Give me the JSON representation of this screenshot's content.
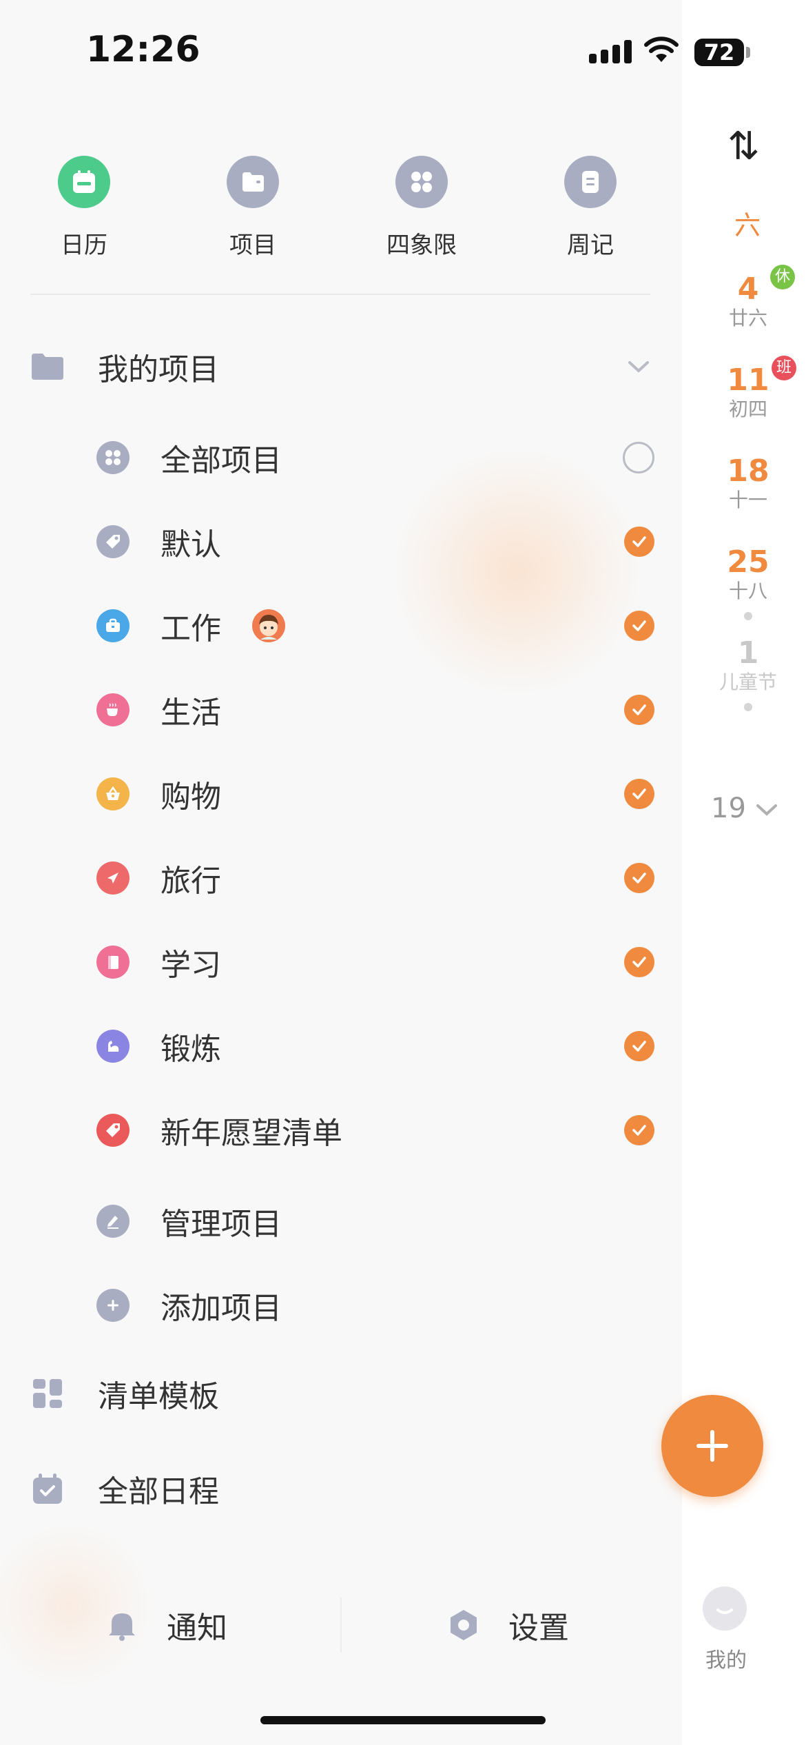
{
  "status_bar": {
    "time": "12:26",
    "battery": "72"
  },
  "shortcuts": [
    {
      "label": "日历",
      "icon": "calendar-icon",
      "color": "#4ccb8a"
    },
    {
      "label": "项目",
      "icon": "folder-icon",
      "color": "#a8adc2"
    },
    {
      "label": "四象限",
      "icon": "quadrant-icon",
      "color": "#a8adc2"
    },
    {
      "label": "周记",
      "icon": "note-icon",
      "color": "#a8adc2"
    }
  ],
  "my_projects": {
    "title": "我的项目",
    "items": [
      {
        "label": "全部项目",
        "icon": "grid-icon",
        "color": "#a8adc2",
        "checked": false
      },
      {
        "label": "默认",
        "icon": "tag-icon",
        "color": "#a8adc2",
        "checked": true
      },
      {
        "label": "工作",
        "icon": "briefcase-icon",
        "color": "#4aa8e8",
        "checked": true
      },
      {
        "label": "生活",
        "icon": "cup-icon",
        "color": "#ef6f95",
        "checked": true
      },
      {
        "label": "购物",
        "icon": "basket-icon",
        "color": "#f5b44a",
        "checked": true
      },
      {
        "label": "旅行",
        "icon": "plane-icon",
        "color": "#ee6a6a",
        "checked": true
      },
      {
        "label": "学习",
        "icon": "book-icon",
        "color": "#ef6f95",
        "checked": true
      },
      {
        "label": "锻炼",
        "icon": "muscle-icon",
        "color": "#8a84e2",
        "checked": true
      },
      {
        "label": "新年愿望清单",
        "icon": "tag-icon",
        "color": "#ea5a5a",
        "checked": true
      },
      {
        "label": "管理项目",
        "icon": "edit-icon",
        "color": "#a8adc2"
      },
      {
        "label": "添加项目",
        "icon": "plus-circle-icon",
        "color": "#a8adc2"
      }
    ]
  },
  "templates": {
    "label": "清单模板"
  },
  "all_schedule": {
    "label": "全部日程"
  },
  "bottom": {
    "notify": "通知",
    "settings": "设置"
  },
  "right_panel": {
    "weekday": "六",
    "days": [
      {
        "num": "4",
        "sub": "廿六",
        "badge": "休",
        "badge_color": "#79c447"
      },
      {
        "num": "11",
        "sub": "初四",
        "badge": "班",
        "badge_color": "#e8505b"
      },
      {
        "num": "18",
        "sub": "十一"
      },
      {
        "num": "25",
        "sub": "十八"
      },
      {
        "num": "1",
        "sub": "儿童节"
      }
    ],
    "week_number": "19",
    "me": "我的"
  },
  "colors": {
    "accent": "#f08a3e",
    "text": "#333333",
    "muted": "#a8adc2"
  }
}
